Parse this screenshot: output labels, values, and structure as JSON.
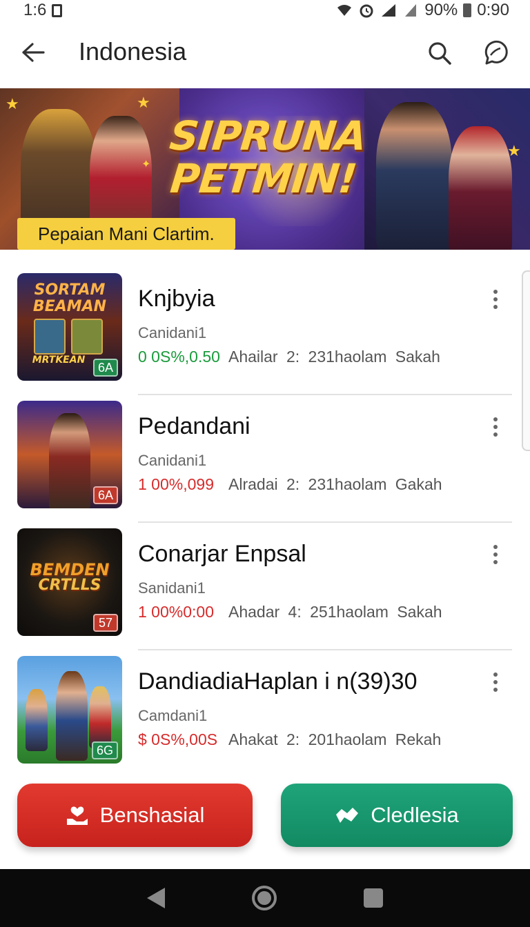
{
  "status_bar": {
    "time": "1:6",
    "battery": "90%",
    "clock": "0:90"
  },
  "app_bar": {
    "title": "Indonesia",
    "back_icon": "arrow-left-icon",
    "search_icon": "search-icon",
    "chat_icon": "chat-bubble-icon"
  },
  "banner": {
    "headline_line1": "SIPRUNA",
    "headline_line2": "PETMIN!",
    "tagline": "Pepaian Mani Clartim."
  },
  "items": [
    {
      "title": "Knjbyia",
      "subtitle": "Canidani1",
      "price": "0 0S%,0.50",
      "price_color": "#1a9b3c",
      "meta": "Ahailar 2: 231haolam Sakah",
      "thumb_line1": "SORTAM",
      "thumb_line2": "BEAMAN",
      "thumb_line3": "MRTKEAN",
      "badge": "6A",
      "badge_color": "#1f8a4c"
    },
    {
      "title": "Pedandani",
      "subtitle": "Canidani1",
      "price": "1 00%,099",
      "price_color": "#d62c2c",
      "meta": "Alradai 2: 231haolam Gakah",
      "badge": "6A",
      "badge_color": "#c0392b"
    },
    {
      "title": "Conarjar Enpsal",
      "subtitle": "Sanidani1",
      "price": "1 00%0:00",
      "price_color": "#d62c2c",
      "meta": "Ahadar 4: 251haolam Sakah",
      "thumb_line1": "BEMDEN",
      "thumb_line2": "CRTLLS",
      "badge": "57",
      "badge_color": "#c0392b"
    },
    {
      "title": "DandiadiaHaplan i n(39)30",
      "subtitle": "Camdani1",
      "price": "$ 0S%,00S",
      "price_color": "#d62c2c",
      "meta": "Ahakat 2: 201haolam Rekah",
      "badge": "6G",
      "badge_color": "#1f8a4c"
    }
  ],
  "actions": {
    "primary_label": "Benshasial",
    "primary_icon": "hand-heart-icon",
    "secondary_label": "Cledlesia",
    "secondary_icon": "handshake-icon"
  },
  "nav_bar": {
    "back": "nav-back-icon",
    "home": "nav-home-icon",
    "recents": "nav-recents-icon"
  }
}
